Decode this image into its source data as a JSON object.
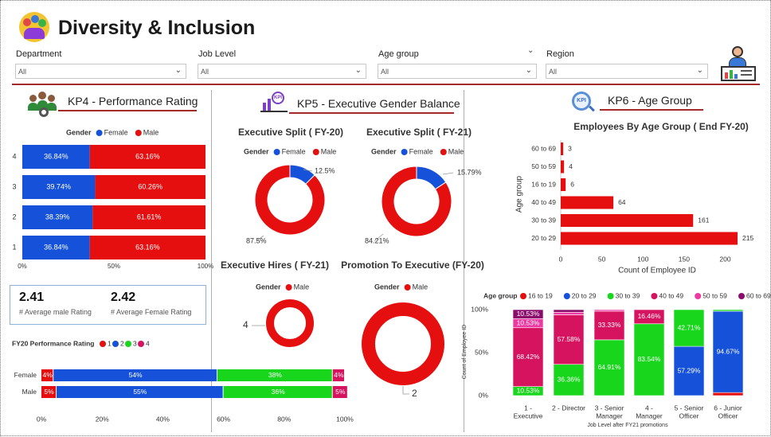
{
  "header": {
    "title": "Diversity & Inclusion",
    "filters": [
      {
        "label": "Department",
        "value": "All"
      },
      {
        "label": "Job Level",
        "value": "All"
      },
      {
        "label": "Age group",
        "value": "All"
      },
      {
        "label": "Region",
        "value": "All"
      }
    ]
  },
  "sections": {
    "kp4": "KP4 - Performance Rating",
    "kp5": "KP5 - Executive Gender Balance",
    "kp6": "KP6 - Age Group"
  },
  "kpis": {
    "male_value": "2.41",
    "male_label": "# Average male Rating",
    "female_value": "2.42",
    "female_label": "# Average Female Rating"
  },
  "colors": {
    "female": "#1652d9",
    "male": "#e50f0f",
    "green": "#18d61c",
    "pink": "#d6135f",
    "purple": "#8a0d6b",
    "magenta": "#ec3aa3",
    "accent": "#a52a2a"
  },
  "chart_data": [
    {
      "id": "perf_by_rating",
      "type": "bar",
      "orientation": "horizontal",
      "stacked_percent": true,
      "legend_title": "Gender",
      "categories": [
        "4",
        "3",
        "2",
        "1"
      ],
      "series": [
        {
          "name": "Female",
          "values": [
            36.84,
            39.74,
            38.39,
            36.84
          ],
          "labels": [
            "36.84%",
            "39.74%",
            "38.39%",
            "36.84%"
          ]
        },
        {
          "name": "Male",
          "values": [
            63.16,
            60.26,
            61.61,
            63.16
          ],
          "labels": [
            "63.16%",
            "60.26%",
            "61.61%",
            "63.16%"
          ]
        }
      ],
      "xticks": [
        "0%",
        "50%",
        "100%"
      ]
    },
    {
      "id": "fy20_perf",
      "type": "bar",
      "orientation": "horizontal",
      "stacked_percent": true,
      "title": "FY20 Performance Rating",
      "categories": [
        "Female",
        "Male"
      ],
      "series": [
        {
          "name": "1",
          "values": [
            4,
            5
          ],
          "labels": [
            "4%",
            "5%"
          ]
        },
        {
          "name": "2",
          "values": [
            54,
            55
          ],
          "labels": [
            "54%",
            "55%"
          ]
        },
        {
          "name": "3",
          "values": [
            38,
            36
          ],
          "labels": [
            "38%",
            "36%"
          ]
        },
        {
          "name": "4",
          "values": [
            4,
            5
          ],
          "labels": [
            "4%",
            "5%"
          ]
        }
      ],
      "xticks": [
        "0%",
        "20%",
        "40%",
        "60%",
        "80%",
        "100%"
      ]
    },
    {
      "id": "exec_split_fy20",
      "type": "pie",
      "donut": true,
      "title": "Executive Split ( FY-20)",
      "legend_title": "Gender",
      "legend": [
        "Female",
        "Male"
      ],
      "slices": [
        {
          "name": "Female",
          "value": 12.5,
          "label": "12.5%"
        },
        {
          "name": "Male",
          "value": 87.5,
          "label": "87.5%"
        }
      ]
    },
    {
      "id": "exec_split_fy21",
      "type": "pie",
      "donut": true,
      "title": "Executive Split ( FY-21)",
      "legend_title": "Gender",
      "legend": [
        "Female",
        "Male"
      ],
      "slices": [
        {
          "name": "Female",
          "value": 15.79,
          "label": "15.79%"
        },
        {
          "name": "Male",
          "value": 84.21,
          "label": "84.21%"
        }
      ]
    },
    {
      "id": "exec_hires_fy21",
      "type": "pie",
      "donut": true,
      "title": "Executive Hires ( FY-21)",
      "legend_title": "Gender",
      "legend": [
        "Male"
      ],
      "slices": [
        {
          "name": "Male",
          "value": 4,
          "label": "4"
        }
      ]
    },
    {
      "id": "promo_exec_fy20",
      "type": "pie",
      "donut": true,
      "title": "Promotion To Executive (FY-20)",
      "legend_title": "Gender",
      "legend": [
        "Male"
      ],
      "slices": [
        {
          "name": "Male",
          "value": 2,
          "label": "2"
        }
      ]
    },
    {
      "id": "age_group",
      "type": "bar",
      "orientation": "horizontal",
      "title": "Employees By Age Group ( End FY-20)",
      "xlabel": "Count of Employee ID",
      "ylabel": "Age group",
      "categories": [
        "60 to 69",
        "50 to 59",
        "16 to 19",
        "40 to 49",
        "30 to 39",
        "20 to 29"
      ],
      "values": [
        3,
        4,
        6,
        64,
        161,
        215
      ],
      "xlim": [
        0,
        215
      ],
      "xticks": [
        0,
        50,
        100,
        150,
        200
      ]
    },
    {
      "id": "promo_by_level",
      "type": "bar",
      "orientation": "vertical",
      "stacked_percent": true,
      "legend_title": "Age group",
      "xlabel": "Job Level after FY21 promotions",
      "ylabel": "Count of Employee ID",
      "categories": [
        "1 - Executive",
        "2 - Director",
        "3 - Senior Manager",
        "4 - Manager",
        "5 - Senior Officer",
        "6 - Junior Officer"
      ],
      "legend": [
        "16 to 19",
        "20 to 29",
        "30 to 39",
        "40 to 49",
        "50 to 59",
        "60 to 69"
      ],
      "yticks": [
        "0%",
        "50%",
        "100%"
      ],
      "stacks": [
        [
          {
            "series": "30 to 39",
            "value": 10.53,
            "label": "10.53%"
          },
          {
            "series": "40 to 49",
            "value": 68.42,
            "label": "68.42%"
          },
          {
            "series": "50 to 59",
            "value": 10.53,
            "label": "10.53%"
          },
          {
            "series": "60 to 69",
            "value": 10.52,
            "label": "10.53%"
          }
        ],
        [
          {
            "series": "30 to 39",
            "value": 36.36,
            "label": "36.36%"
          },
          {
            "series": "40 to 49",
            "value": 57.58,
            "label": "57.58%"
          },
          {
            "series": "50 to 59",
            "value": 3.03,
            "label": ""
          },
          {
            "series": "60 to 69",
            "value": 3.03,
            "label": ""
          }
        ],
        [
          {
            "series": "30 to 39",
            "value": 64.91,
            "label": "64.91%"
          },
          {
            "series": "40 to 49",
            "value": 33.33,
            "label": "33.33%"
          },
          {
            "series": "50 to 59",
            "value": 1.76,
            "label": ""
          }
        ],
        [
          {
            "series": "30 to 39",
            "value": 83.54,
            "label": "83.54%"
          },
          {
            "series": "40 to 49",
            "value": 16.46,
            "label": "16.46%"
          }
        ],
        [
          {
            "series": "20 to 29",
            "value": 57.29,
            "label": "57.29%"
          },
          {
            "series": "30 to 39",
            "value": 42.71,
            "label": "42.71%"
          }
        ],
        [
          {
            "series": "16 to 19",
            "value": 3.54,
            "label": ""
          },
          {
            "series": "20 to 29",
            "value": 94.67,
            "label": "94.67%"
          },
          {
            "series": "30 to 39",
            "value": 1.79,
            "label": ""
          }
        ]
      ]
    }
  ]
}
